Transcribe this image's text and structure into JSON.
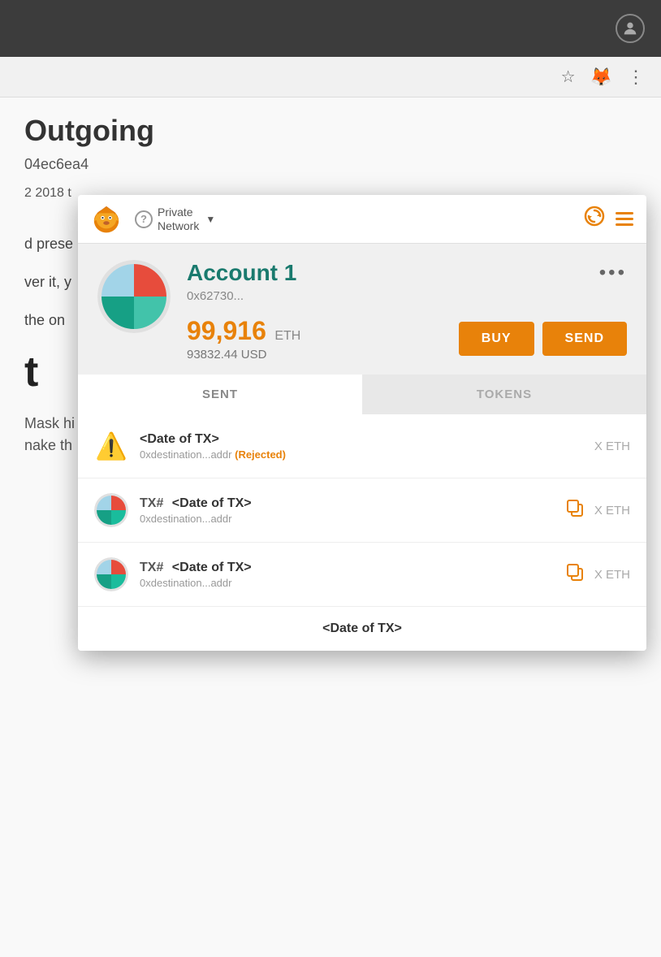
{
  "browser": {
    "profile_icon": "👤",
    "toolbar": {
      "star_icon": "☆",
      "extension_icon": "🦊",
      "menu_icon": "⋮"
    }
  },
  "background": {
    "title": "Outgoing",
    "address": "04ec6ea4",
    "date": "2 2018 t",
    "text1": "d prese",
    "text2_prefix": "ver it, y",
    "text2_suffix": "the on",
    "text3": "t",
    "text4": "Mask hi",
    "text5": "nake th"
  },
  "metamask": {
    "network_label": "Private\nNetwork",
    "account_name": "Account 1",
    "account_address": "0x62730...",
    "balance_eth": "99,916",
    "balance_eth_label": "ETH",
    "balance_usd": "93832.44",
    "balance_usd_label": "USD",
    "btn_buy": "BUY",
    "btn_send": "SEND",
    "tabs": [
      {
        "id": "sent",
        "label": "SENT",
        "active": true
      },
      {
        "id": "tokens",
        "label": "TOKENS",
        "active": false
      }
    ],
    "transactions": [
      {
        "id": "tx-rejected",
        "type": "warning",
        "date": "<Date of TX>",
        "address": "0xdestination...addr",
        "status": "Rejected",
        "amount": "X ETH",
        "has_copy": false
      },
      {
        "id": "tx-1",
        "type": "normal",
        "tx_num": "TX#",
        "date": "<Date of TX>",
        "address": "0xdestination...addr",
        "status": "",
        "amount": "X ETH",
        "has_copy": true
      },
      {
        "id": "tx-2",
        "type": "normal",
        "tx_num": "TX#",
        "date": "<Date of TX>",
        "address": "0xdestination...addr",
        "status": "",
        "amount": "X ETH",
        "has_copy": true
      },
      {
        "id": "tx-3",
        "type": "partial",
        "date": "<Date of TX>"
      }
    ],
    "more_dots": "•••",
    "rejected_label": "Rejected"
  }
}
